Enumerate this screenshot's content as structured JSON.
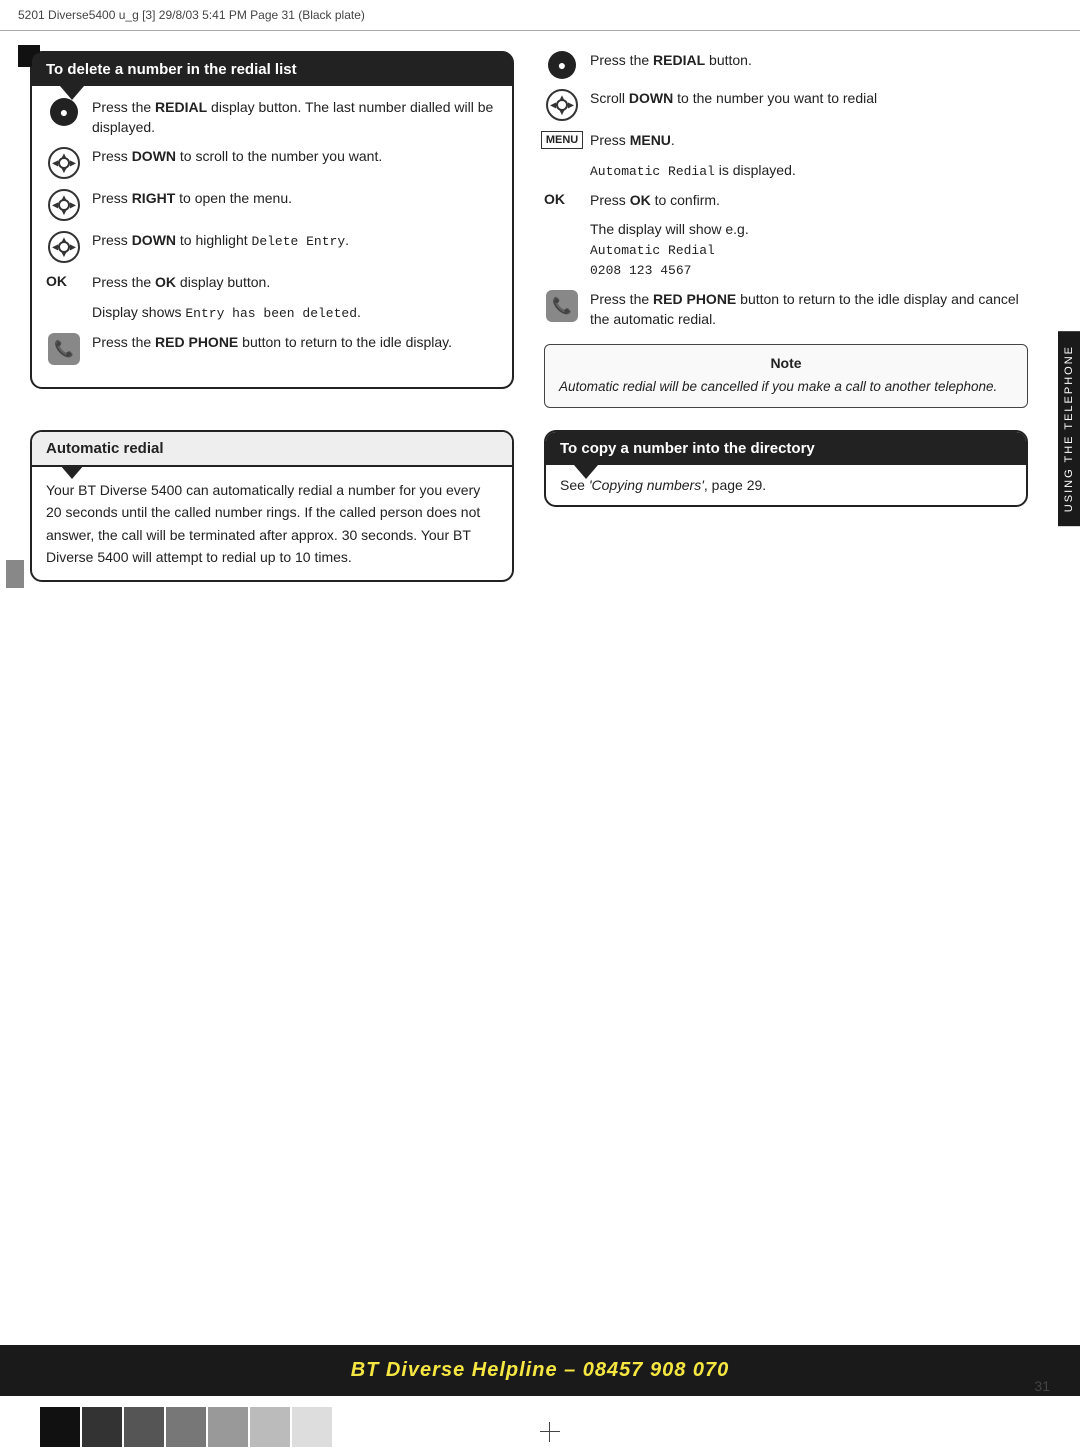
{
  "header": {
    "text": "5201 Diverse5400  u_g [3]  29/8/03  5:41 PM  Page 31    (Black plate)"
  },
  "page_number": "31",
  "side_tab": "USING THE TELEPHONE",
  "delete_section": {
    "title": "To delete a number in the redial list",
    "steps": [
      {
        "icon": "redial",
        "text": "Press the <b>REDIAL</b> display button. The last number dialled will be displayed."
      },
      {
        "icon": "navpad",
        "text": "Press <b>DOWN</b> to scroll to the number you want."
      },
      {
        "icon": "navpad",
        "text": "Press <b>RIGHT</b> to open the menu."
      },
      {
        "icon": "navpad",
        "text": "Press <b>DOWN</b> to highlight <span class='monospace'>Delete Entry</span>."
      },
      {
        "icon": "ok",
        "label": "OK",
        "text": "Press the <b>OK</b> display button."
      },
      {
        "icon": "text",
        "text": "Display shows <span class='monospace'>Entry has been deleted</span>."
      },
      {
        "icon": "redphone",
        "text": "Press the <b>RED PHONE</b> button to return to the idle display."
      }
    ]
  },
  "automatic_redial": {
    "title": "Automatic redial",
    "body": "Your BT Diverse 5400 can automatically redial a number for you every 20 seconds until the called number rings. If the called person does not answer, the call will be terminated after approx. 30 seconds. Your BT Diverse 5400 will attempt to redial up to 10 times."
  },
  "right_col": {
    "steps": [
      {
        "icon": "redial",
        "text": "Press the <b>REDIAL</b> button."
      },
      {
        "icon": "navpad",
        "text": "Scroll <b>DOWN</b> to the number you want to redial"
      },
      {
        "icon": "menu",
        "label": "MENU",
        "text": "Press <b>MENU</b>."
      },
      {
        "icon": "text",
        "text": "<span class='monospace'>Automatic Redial</span> is displayed."
      },
      {
        "icon": "ok",
        "label": "OK",
        "text": "Press <b>OK</b> to confirm."
      },
      {
        "icon": "text",
        "text": "The display will show e.g.<br><span class='monospace'>Automatic Redial<br>0208 123 4567</span>"
      },
      {
        "icon": "redphone",
        "text": "Press the <b>RED PHONE</b> button to return to the idle display and cancel the automatic redial."
      }
    ],
    "note": {
      "title": "Note",
      "text": "Automatic redial will be cancelled if you make a call to another telephone."
    }
  },
  "copy_section": {
    "title": "To copy a number into the directory",
    "body": "See <i>'Copying numbers'</i>, page 29."
  },
  "helpline": {
    "text": "BT Diverse Helpline – 08457 908 070"
  },
  "color_squares": [
    "#111111",
    "#333333",
    "#555555",
    "#777777",
    "#999999",
    "#bbbbbb",
    "#dddddd",
    "#eeeeee"
  ]
}
